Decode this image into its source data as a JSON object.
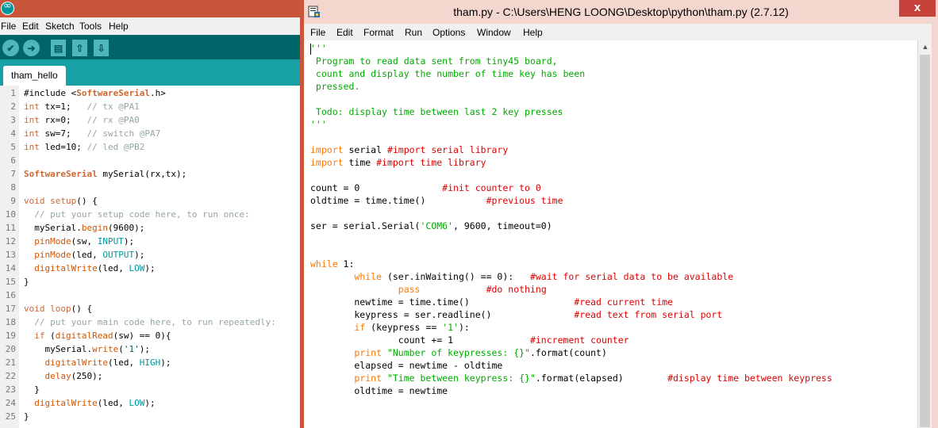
{
  "arduino": {
    "menu": [
      "File",
      "Edit",
      "Sketch",
      "Tools",
      "Help"
    ],
    "toolbar": {
      "verify_glyph": "✔",
      "upload_glyph": "➜",
      "new_glyph": "▤",
      "open_glyph": "⇧",
      "save_glyph": "⇩"
    },
    "tab_name": "tham_hello",
    "line_numbers": [
      "1",
      "2",
      "3",
      "4",
      "5",
      "6",
      "7",
      "8",
      "9",
      "10",
      "11",
      "12",
      "13",
      "14",
      "15",
      "16",
      "17",
      "18",
      "19",
      "20",
      "21",
      "22",
      "23",
      "24",
      "25"
    ],
    "code": [
      [
        {
          "t": "#include <"
        },
        {
          "t": "SoftwareSerial",
          "c": "a-class"
        },
        {
          "t": ".h>"
        }
      ],
      [
        {
          "t": "int",
          "c": "a-type"
        },
        {
          "t": " tx=1;   "
        },
        {
          "t": "// tx @PA1",
          "c": "a-com"
        }
      ],
      [
        {
          "t": "int",
          "c": "a-type"
        },
        {
          "t": " rx=0;   "
        },
        {
          "t": "// rx @PA0",
          "c": "a-com"
        }
      ],
      [
        {
          "t": "int",
          "c": "a-type"
        },
        {
          "t": " sw=7;   "
        },
        {
          "t": "// switch @PA7",
          "c": "a-com"
        }
      ],
      [
        {
          "t": "int",
          "c": "a-type"
        },
        {
          "t": " led=10; "
        },
        {
          "t": "// led @PB2",
          "c": "a-com"
        }
      ],
      [],
      [
        {
          "t": "SoftwareSerial",
          "c": "a-class"
        },
        {
          "t": " mySerial(rx,tx);"
        }
      ],
      [],
      [
        {
          "t": "void",
          "c": "a-type"
        },
        {
          "t": " "
        },
        {
          "t": "setup",
          "c": "a-kw"
        },
        {
          "t": "() {"
        }
      ],
      [
        {
          "t": "  "
        },
        {
          "t": "// put your setup code here, to run once:",
          "c": "a-com"
        }
      ],
      [
        {
          "t": "  mySerial."
        },
        {
          "t": "begin",
          "c": "a-fn"
        },
        {
          "t": "(9600);"
        }
      ],
      [
        {
          "t": "  "
        },
        {
          "t": "pinMode",
          "c": "a-fn"
        },
        {
          "t": "(sw, "
        },
        {
          "t": "INPUT",
          "c": "a-const"
        },
        {
          "t": ");"
        }
      ],
      [
        {
          "t": "  "
        },
        {
          "t": "pinMode",
          "c": "a-fn"
        },
        {
          "t": "(led, "
        },
        {
          "t": "OUTPUT",
          "c": "a-const"
        },
        {
          "t": ");"
        }
      ],
      [
        {
          "t": "  "
        },
        {
          "t": "digitalWrite",
          "c": "a-fn"
        },
        {
          "t": "(led, "
        },
        {
          "t": "LOW",
          "c": "a-const"
        },
        {
          "t": ");"
        }
      ],
      [
        {
          "t": "}"
        }
      ],
      [],
      [
        {
          "t": "void",
          "c": "a-type"
        },
        {
          "t": " "
        },
        {
          "t": "loop",
          "c": "a-kw"
        },
        {
          "t": "() {"
        }
      ],
      [
        {
          "t": "  "
        },
        {
          "t": "// put your main code here, to run repeatedly:",
          "c": "a-com"
        }
      ],
      [
        {
          "t": "  "
        },
        {
          "t": "if",
          "c": "a-kw"
        },
        {
          "t": " ("
        },
        {
          "t": "digitalRead",
          "c": "a-fn"
        },
        {
          "t": "(sw) == 0){"
        }
      ],
      [
        {
          "t": "    mySerial."
        },
        {
          "t": "write",
          "c": "a-fn"
        },
        {
          "t": "("
        },
        {
          "t": "'1'",
          "c": "a-str"
        },
        {
          "t": ");"
        }
      ],
      [
        {
          "t": "    "
        },
        {
          "t": "digitalWrite",
          "c": "a-fn"
        },
        {
          "t": "(led, "
        },
        {
          "t": "HIGH",
          "c": "a-const"
        },
        {
          "t": ");"
        }
      ],
      [
        {
          "t": "    "
        },
        {
          "t": "delay",
          "c": "a-fn"
        },
        {
          "t": "(250);"
        }
      ],
      [
        {
          "t": "  }"
        }
      ],
      [
        {
          "t": "  "
        },
        {
          "t": "digitalWrite",
          "c": "a-fn"
        },
        {
          "t": "(led, "
        },
        {
          "t": "LOW",
          "c": "a-const"
        },
        {
          "t": ");"
        }
      ],
      [
        {
          "t": "}"
        }
      ]
    ]
  },
  "idle": {
    "title": "tham.py - C:\\Users\\HENG LOONG\\Desktop\\python\\tham.py (2.7.12)",
    "close_glyph": "x",
    "menu": [
      "File",
      "Edit",
      "Format",
      "Run",
      "Options",
      "Window",
      "Help"
    ],
    "code": [
      [
        {
          "t": "'''",
          "c": "p-str"
        }
      ],
      [
        {
          "t": " Program to read data sent from tiny45 board,",
          "c": "p-str"
        }
      ],
      [
        {
          "t": " count and display the number of time key has been",
          "c": "p-str"
        }
      ],
      [
        {
          "t": " pressed.",
          "c": "p-str"
        }
      ],
      [],
      [
        {
          "t": " Todo: display time between last 2 key presses",
          "c": "p-str"
        }
      ],
      [
        {
          "t": "'''",
          "c": "p-str"
        }
      ],
      [],
      [
        {
          "t": "import",
          "c": "p-kw"
        },
        {
          "t": " serial "
        },
        {
          "t": "#import serial library",
          "c": "p-com"
        }
      ],
      [
        {
          "t": "import",
          "c": "p-kw"
        },
        {
          "t": " time "
        },
        {
          "t": "#import time library",
          "c": "p-com"
        }
      ],
      [],
      [
        {
          "t": "count = 0               "
        },
        {
          "t": "#init counter to 0",
          "c": "p-com"
        }
      ],
      [
        {
          "t": "oldtime = time.time()           "
        },
        {
          "t": "#previous time",
          "c": "p-com"
        }
      ],
      [],
      [
        {
          "t": "ser = serial.Serial("
        },
        {
          "t": "'COM6'",
          "c": "p-str"
        },
        {
          "t": ", 9600, timeout=0)"
        }
      ],
      [],
      [],
      [
        {
          "t": "while",
          "c": "p-kw"
        },
        {
          "t": " 1:"
        }
      ],
      [
        {
          "t": "        "
        },
        {
          "t": "while",
          "c": "p-kw"
        },
        {
          "t": " (ser.inWaiting() == 0):   "
        },
        {
          "t": "#wait for serial data to be available",
          "c": "p-com"
        }
      ],
      [
        {
          "t": "                "
        },
        {
          "t": "pass",
          "c": "p-kw"
        },
        {
          "t": "            "
        },
        {
          "t": "#do nothing",
          "c": "p-com"
        }
      ],
      [
        {
          "t": "        newtime = time.time()                   "
        },
        {
          "t": "#read current time",
          "c": "p-com"
        }
      ],
      [
        {
          "t": "        keypress = ser.readline()               "
        },
        {
          "t": "#read text from serial port",
          "c": "p-com"
        }
      ],
      [
        {
          "t": "        "
        },
        {
          "t": "if",
          "c": "p-kw"
        },
        {
          "t": " (keypress == "
        },
        {
          "t": "'1'",
          "c": "p-str"
        },
        {
          "t": "):"
        }
      ],
      [
        {
          "t": "                count += 1              "
        },
        {
          "t": "#increment counter",
          "c": "p-com"
        }
      ],
      [
        {
          "t": "        "
        },
        {
          "t": "print",
          "c": "p-kw"
        },
        {
          "t": " "
        },
        {
          "t": "\"Number of keypresses: {}\"",
          "c": "p-str"
        },
        {
          "t": ".format(count)"
        }
      ],
      [
        {
          "t": "        elapsed = newtime - oldtime"
        }
      ],
      [
        {
          "t": "        "
        },
        {
          "t": "print",
          "c": "p-kw"
        },
        {
          "t": " "
        },
        {
          "t": "\"Time between keypress: {}\"",
          "c": "p-str"
        },
        {
          "t": ".format(elapsed)        "
        },
        {
          "t": "#display time between keypress",
          "c": "p-com"
        }
      ],
      [
        {
          "t": "        oldtime = newtime"
        }
      ]
    ]
  }
}
